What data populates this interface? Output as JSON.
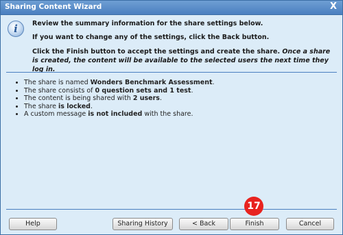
{
  "dialog": {
    "title": "Sharing Content Wizard",
    "close_glyph": "X",
    "accent": "#4a7fc0",
    "background": "#dcecf8"
  },
  "icons": {
    "info": "i"
  },
  "instructions": {
    "line1": "Review the summary information for the share settings below.",
    "line2": "If you want to change any of the settings, click the Back button.",
    "line3a": "Click the Finish button to accept the settings and create the share. ",
    "line3b": "Once a share is created, the content will be available to the selected users the next time they log in."
  },
  "summary": [
    {
      "pre": "The share is named ",
      "bold": "Wonders Benchmark Assessment",
      "post": "."
    },
    {
      "pre": "The share consists of ",
      "bold": "0 question sets and 1 test",
      "post": "."
    },
    {
      "pre": "The content is being shared with ",
      "bold": "2 users",
      "post": "."
    },
    {
      "pre": "The share ",
      "bold": "is locked",
      "post": "."
    },
    {
      "pre": "A custom message ",
      "bold": "is not included",
      "post": " with the share."
    }
  ],
  "buttons": {
    "help": "Help",
    "history": "Sharing History",
    "back": "< Back",
    "finish": "Finish",
    "cancel": "Cancel"
  },
  "step_badge": "17"
}
